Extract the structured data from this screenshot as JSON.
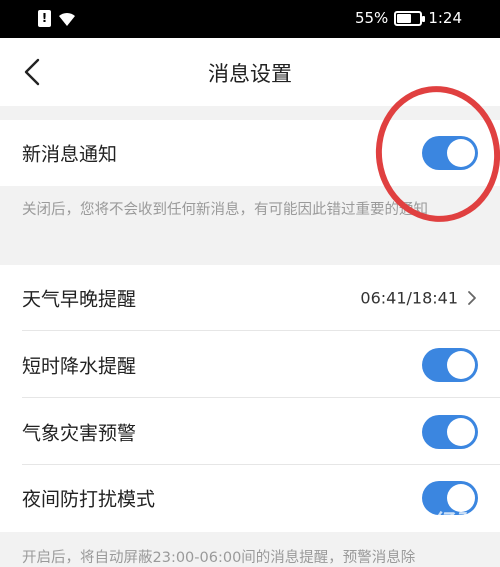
{
  "status_bar": {
    "battery": "55%",
    "time": "1:24",
    "battery_level": 0.55,
    "icons": [
      "alert-icon",
      "wifi-icon",
      "battery-icon"
    ]
  },
  "header": {
    "title": "消息设置",
    "back_icon": "chevron-left-icon"
  },
  "new_message": {
    "label": "新消息通知",
    "enabled": true,
    "description": "关闭后，您将不会收到任何新消息，有可能因此错过重要的通知"
  },
  "settings": {
    "weather_reminder": {
      "label": "天气早晚提醒",
      "value": "06:41/18:41",
      "icon": "chevron-right-icon"
    },
    "rain_reminder": {
      "label": "短时降水提醒",
      "enabled": true
    },
    "disaster_warning": {
      "label": "气象灾害预警",
      "enabled": true
    },
    "night_mode": {
      "label": "夜间防打扰模式",
      "enabled": true
    },
    "night_description": "开启后，将自动屏蔽23:00-06:00间的消息提醒，预警消息除"
  },
  "colors": {
    "toggle_on": "#3b86e0",
    "annotation": "#e04040",
    "background": "#f2f2f2"
  },
  "watermark": "Bai 经验"
}
